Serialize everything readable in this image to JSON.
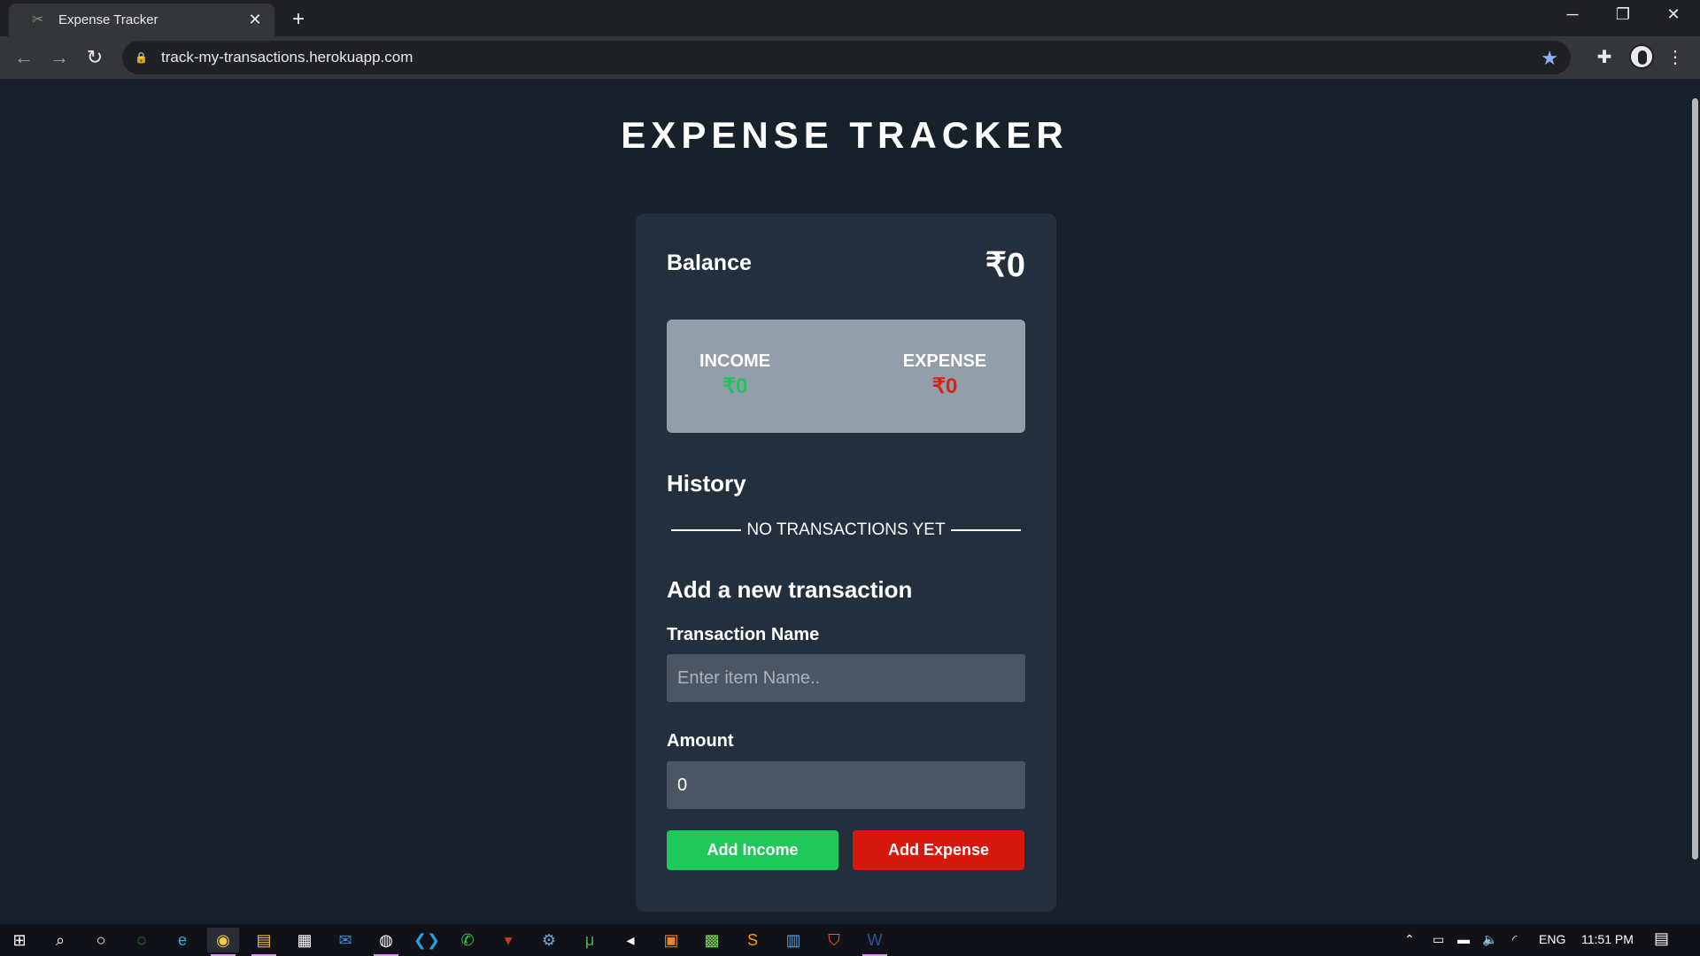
{
  "browser": {
    "tab_title": "Expense Tracker",
    "new_tab_icon": "+",
    "url": "track-my-transactions.herokuapp.com",
    "accent": "#8ab4f8"
  },
  "app": {
    "title": "EXPENSE TRACKER",
    "balance_label": "Balance",
    "balance_value": "₹0",
    "income_label": "INCOME",
    "income_value": "₹0",
    "income_color": "#23c45c",
    "expense_label": "EXPENSE",
    "expense_value": "₹0",
    "expense_color": "#d7231a",
    "history_title": "History",
    "empty_text": "NO TRANSACTIONS YET",
    "add_title": "Add a new transaction",
    "name_label": "Transaction Name",
    "name_placeholder": "Enter item Name..",
    "amount_label": "Amount",
    "amount_value": "0",
    "add_income_label": "Add Income",
    "add_expense_label": "Add Expense"
  },
  "taskbar": {
    "language": "ENG",
    "time": "11:51 PM"
  }
}
